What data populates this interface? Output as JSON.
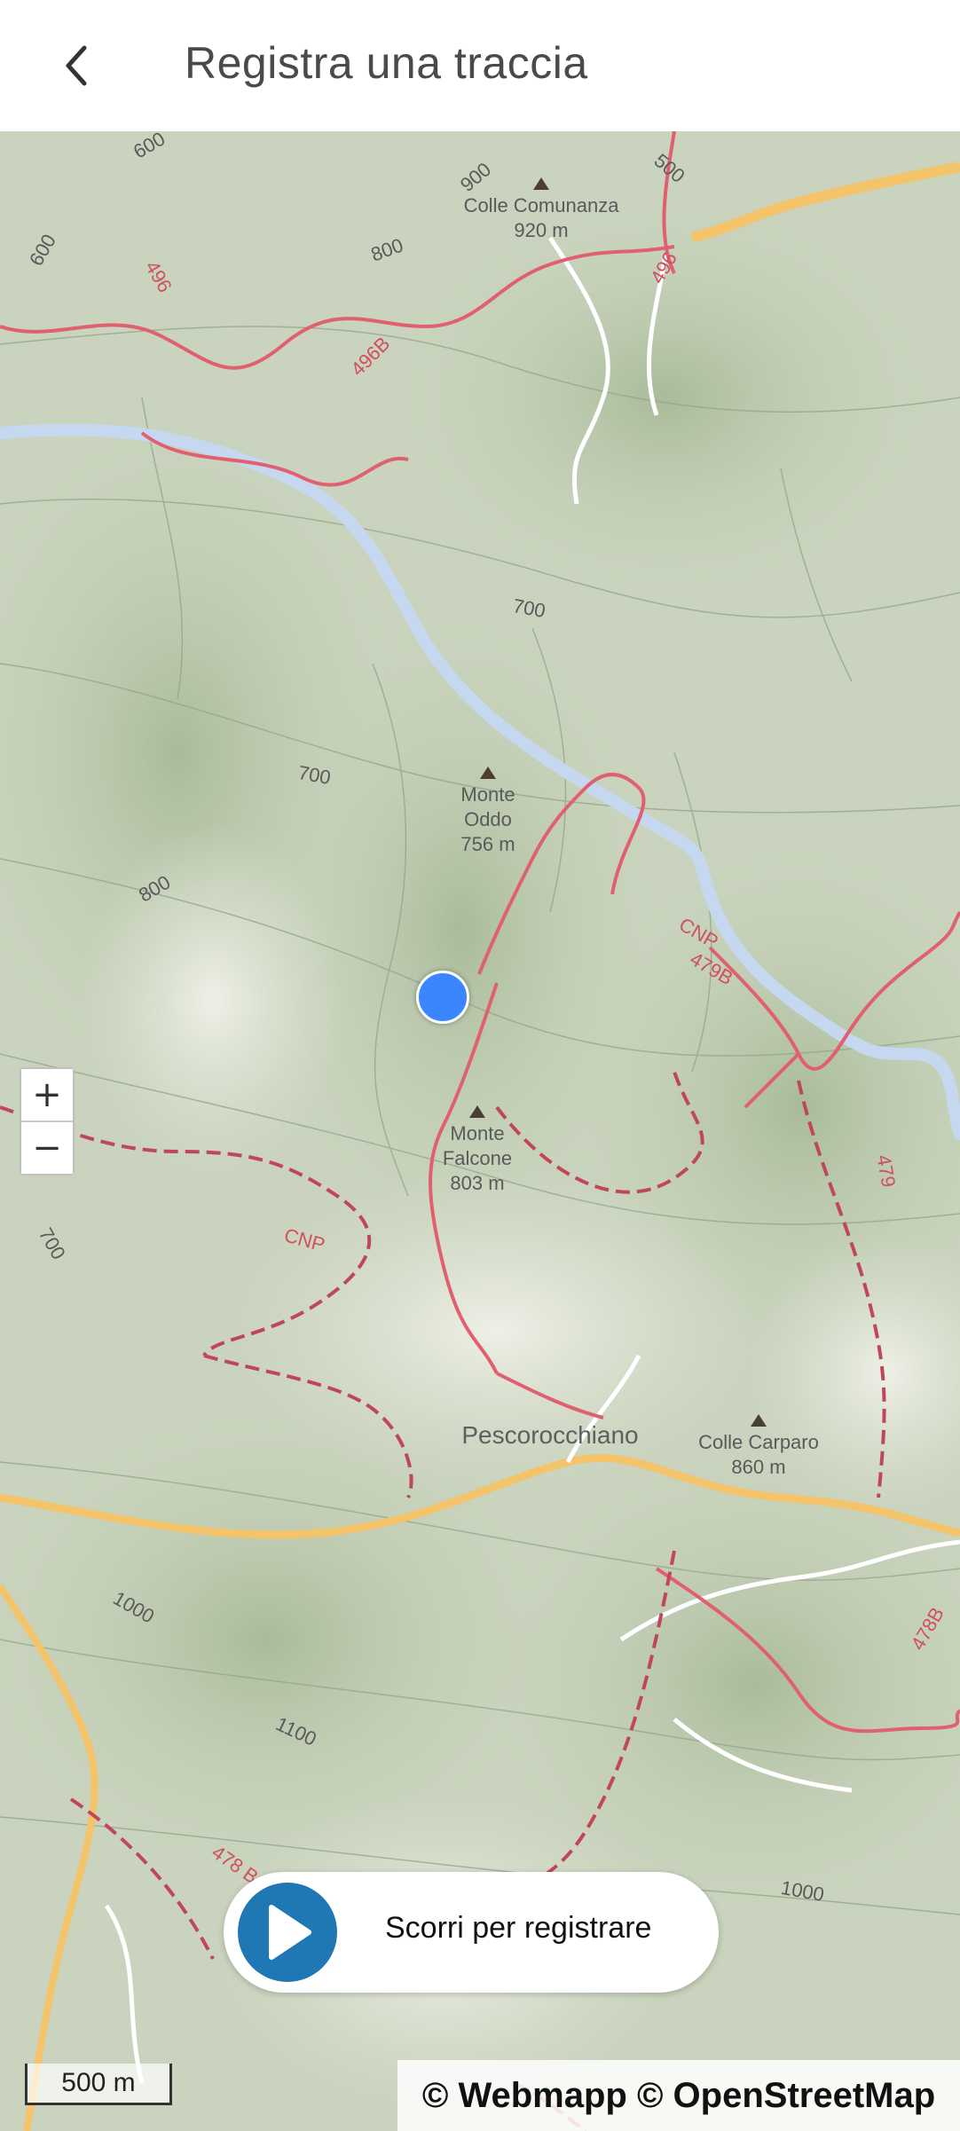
{
  "header": {
    "title": "Registra una traccia",
    "back_icon": "chevron-left-icon"
  },
  "map": {
    "labels": {
      "colle_comunanza": "Colle Comunanza",
      "colle_comunanza_alt": "920 m",
      "monte_oddo_1": "Monte",
      "monte_oddo_2": "Oddo",
      "monte_oddo_alt": "756 m",
      "monte_falcone_1": "Monte",
      "monte_falcone_2": "Falcone",
      "monte_falcone_alt": "803 m",
      "pescorocchiano": "Pescorocchiano",
      "colle_carparo": "Colle Carparo",
      "colle_carparo_alt": "860 m"
    },
    "contours": [
      "600",
      "900",
      "800",
      "600",
      "500",
      "700",
      "700",
      "800",
      "700",
      "1000",
      "1100",
      "1000"
    ],
    "trails": [
      "496",
      "496",
      "496B",
      "CNP",
      "479B",
      "CNP",
      "479",
      "478B",
      "478 B"
    ],
    "zoom_in": "+",
    "zoom_out": "−",
    "scale_label": "500 m",
    "attribution": "© Webmapp © OpenStreetMap"
  },
  "record": {
    "label": "Scorri per registrare",
    "icon": "play-icon"
  },
  "colors": {
    "accent": "#1f78b4",
    "location": "#3b86ff",
    "trail": "#e06070",
    "river": "#c6d8ef",
    "road": "#f4c46a"
  }
}
